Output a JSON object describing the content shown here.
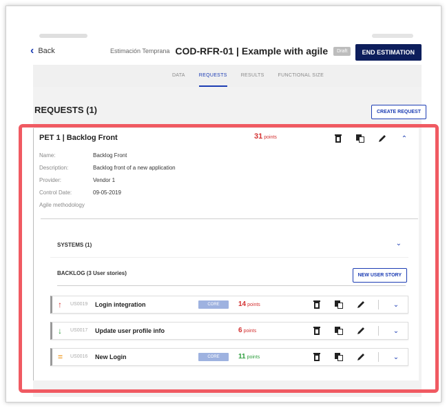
{
  "header": {
    "back_label": "Back",
    "subtitle": "Estimación Temprana",
    "title": "COD-RFR-01 | Example with agile",
    "badge": "Draft",
    "end_button": "END ESTIMATION"
  },
  "tabs": [
    {
      "label": "DATA"
    },
    {
      "label": "REQUESTS"
    },
    {
      "label": "RESULTS"
    },
    {
      "label": "FUNCTIONAL SIZE"
    }
  ],
  "active_tab": "REQUESTS",
  "requests": {
    "title": "REQUESTS (1)",
    "create_button": "CREATE REQUEST"
  },
  "request": {
    "title": "PET 1 | Backlog Front",
    "points": "31",
    "points_unit": "points",
    "details": [
      {
        "label": "Name:",
        "value": "Backlog Front"
      },
      {
        "label": "Description:",
        "value": "Backlog front of a new application"
      },
      {
        "label": "Provider:",
        "value": "Vendor 1"
      },
      {
        "label": "Control Date:",
        "value": "09-05-2019"
      },
      {
        "label": "Agile methodology",
        "value": ""
      }
    ]
  },
  "systems": {
    "label": "SYSTEMS (1)"
  },
  "backlog": {
    "label": "BACKLOG (3 User stories)",
    "new_button": "NEW USER STORY"
  },
  "stories": [
    {
      "arrow": "↑",
      "arrow_color": "#d32f2f",
      "id": "US0019",
      "name": "Login integration",
      "tag": "CORE",
      "points": "14",
      "points_unit": "points",
      "points_color": "#d32f2f"
    },
    {
      "arrow": "↓",
      "arrow_color": "#2e9e3e",
      "id": "US0017",
      "name": "Update user profile info",
      "tag": "",
      "points": "6",
      "points_unit": "points",
      "points_color": "#d32f2f"
    },
    {
      "arrow": "=",
      "arrow_color": "#f0a030",
      "id": "US0016",
      "name": "New Login",
      "tag": "CORE",
      "points": "11",
      "points_unit": "points",
      "points_color": "#2e9e3e"
    }
  ],
  "colors": {
    "accent": "#1a3bb3",
    "primary_dark": "#0d1e5c",
    "highlight": "#f05a62"
  }
}
